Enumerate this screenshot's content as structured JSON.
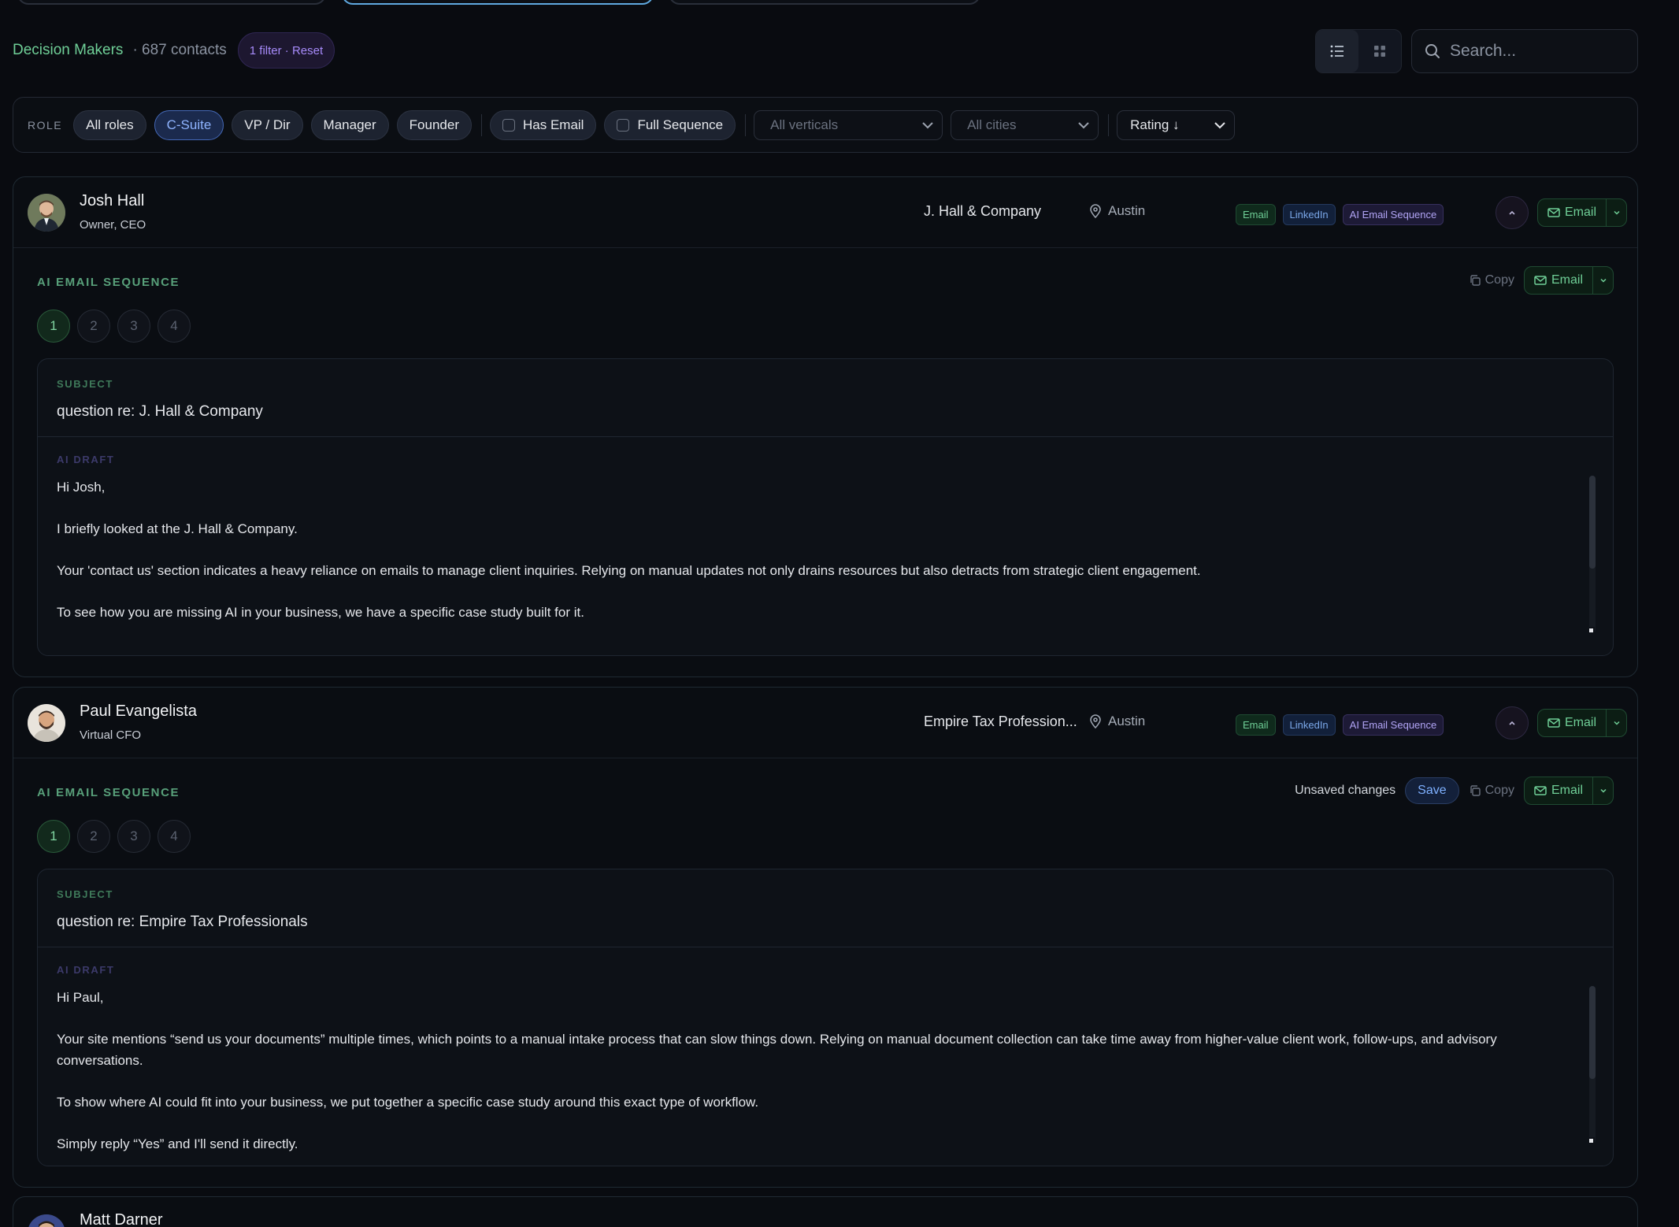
{
  "header": {
    "title": "Decision Makers",
    "count": "· 687 contacts",
    "filter_pill": "1 filter · Reset",
    "search_placeholder": "Search..."
  },
  "filters": {
    "role_label": "ROLE",
    "roles": [
      "All roles",
      "C-Suite",
      "VP / Dir",
      "Manager",
      "Founder"
    ],
    "active_role": "C-Suite",
    "toggles": [
      "Has Email",
      "Full Sequence"
    ],
    "verticals_placeholder": "All verticals",
    "cities_placeholder": "All cities",
    "sort": "Rating ↓"
  },
  "contacts": [
    {
      "name": "Josh Hall",
      "role": "Owner, CEO",
      "company": "J. Hall & Company",
      "city": "Austin",
      "tags": [
        "Email",
        "LinkedIn",
        "AI Email Sequence"
      ],
      "email_label": "Email",
      "sequence_title": "AI EMAIL SEQUENCE",
      "copy_label": "Copy",
      "steps": [
        "1",
        "2",
        "3",
        "4"
      ],
      "subject_label": "SUBJECT",
      "subject": "question re: J. Hall & Company",
      "draft_label": "AI DRAFT",
      "draft": "Hi Josh,\n\nI briefly looked at the J. Hall & Company.\n\nYour 'contact us' section indicates a heavy reliance on emails to manage client inquiries. Relying on manual updates not only drains resources but also detracts from strategic client engagement.\n\nTo see how you are missing AI in your business, we have a specific case study built for it."
    },
    {
      "name": "Paul Evangelista",
      "role": "Virtual CFO",
      "company": "Empire Tax Profession...",
      "city": "Austin",
      "tags": [
        "Email",
        "LinkedIn",
        "AI Email Sequence"
      ],
      "email_label": "Email",
      "sequence_title": "AI EMAIL SEQUENCE",
      "unsaved": "Unsaved changes",
      "save_label": "Save",
      "copy_label": "Copy",
      "steps": [
        "1",
        "2",
        "3",
        "4"
      ],
      "subject_label": "SUBJECT",
      "subject": "question re: Empire Tax Professionals",
      "draft_label": "AI DRAFT",
      "draft": "Hi Paul,\n\nYour site mentions “send us your documents” multiple times, which points to a manual intake process that can slow things down. Relying on manual document collection can take time away from higher-value client work, follow-ups, and advisory conversations.\n\nTo show where AI could fit into your business, we put together a specific case study around this exact type of workflow.\n\nSimply reply “Yes” and I'll send it directly."
    },
    {
      "name": "Matt Darner"
    }
  ]
}
